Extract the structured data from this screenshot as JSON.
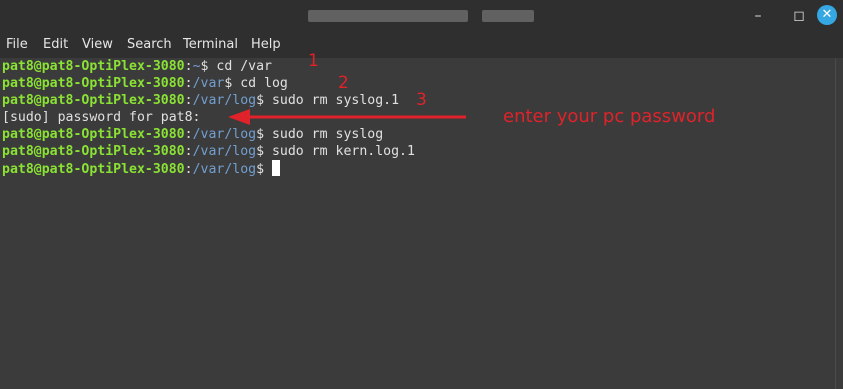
{
  "window": {
    "minimize_icon": "minimize-icon",
    "maximize_icon": "maximize-icon",
    "close_icon": "close-icon",
    "close_color": "#35a7e2"
  },
  "menu": [
    "File",
    "Edit",
    "View",
    "Search",
    "Terminal",
    "Help"
  ],
  "colors": {
    "background": "#3b3b3b",
    "user": "#8ae234",
    "path": "#729fcf",
    "annotation": "#e0222a"
  },
  "terminal": {
    "lines": [
      {
        "user": "pat8@pat8-OptiPlex-3080",
        "sep": ":",
        "path": "~",
        "cmd": "$ cd /var"
      },
      {
        "user": "pat8@pat8-OptiPlex-3080",
        "sep": ":",
        "path": "/var",
        "cmd": "$ cd log"
      },
      {
        "user": "pat8@pat8-OptiPlex-3080",
        "sep": ":",
        "path": "/var/log",
        "cmd": "$ sudo rm syslog.1"
      },
      {
        "text": "[sudo] password for pat8:"
      },
      {
        "user": "pat8@pat8-OptiPlex-3080",
        "sep": ":",
        "path": "/var/log",
        "cmd": "$ sudo rm syslog"
      },
      {
        "user": "pat8@pat8-OptiPlex-3080",
        "sep": ":",
        "path": "/var/log",
        "cmd": "$ sudo rm kern.log.1"
      },
      {
        "user": "pat8@pat8-OptiPlex-3080",
        "sep": ":",
        "path": "/var/log",
        "cmd": "$ "
      }
    ]
  },
  "annotations": {
    "num1": "1",
    "num2": "2",
    "num3": "3",
    "note": "enter your pc password"
  }
}
